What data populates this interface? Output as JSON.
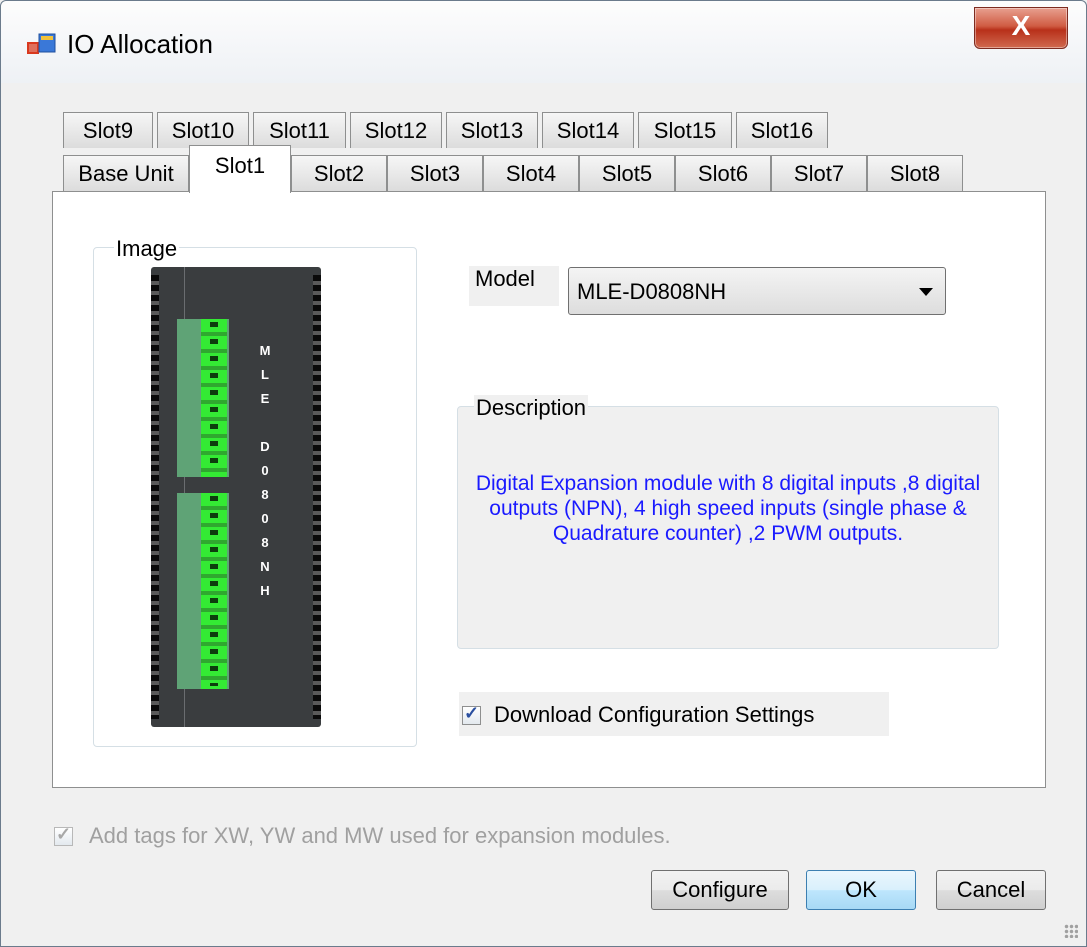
{
  "window": {
    "title": "IO Allocation",
    "close_label": "X"
  },
  "tabs": {
    "row_top": [
      "Slot9",
      "Slot10",
      "Slot11",
      "Slot12",
      "Slot13",
      "Slot14",
      "Slot15",
      "Slot16"
    ],
    "row_bottom": [
      "Base Unit",
      "Slot1",
      "Slot2",
      "Slot3",
      "Slot4",
      "Slot5",
      "Slot6",
      "Slot7",
      "Slot8"
    ],
    "active": "Slot1"
  },
  "image_group": {
    "label": "Image",
    "module_text": "M\nL\nE\n\nD\n0\n8\n0\n8\nN\nH"
  },
  "model": {
    "label": "Model",
    "value": "MLE-D0808NH"
  },
  "description": {
    "label": "Description",
    "text": "Digital Expansion module with 8 digital inputs ,8 digital outputs (NPN), 4 high speed inputs (single phase & Quadrature counter) ,2 PWM outputs."
  },
  "download_config": {
    "label": "Download Configuration Settings",
    "checked": true
  },
  "add_tags": {
    "label": "Add tags for XW, YW and MW used for expansion  modules.",
    "checked": true,
    "enabled": false
  },
  "buttons": {
    "configure": "Configure",
    "ok": "OK",
    "cancel": "Cancel"
  },
  "colors": {
    "description_text": "#1a1aff",
    "terminal_green": "#34ea34",
    "module_body": "#3a3d3f"
  }
}
